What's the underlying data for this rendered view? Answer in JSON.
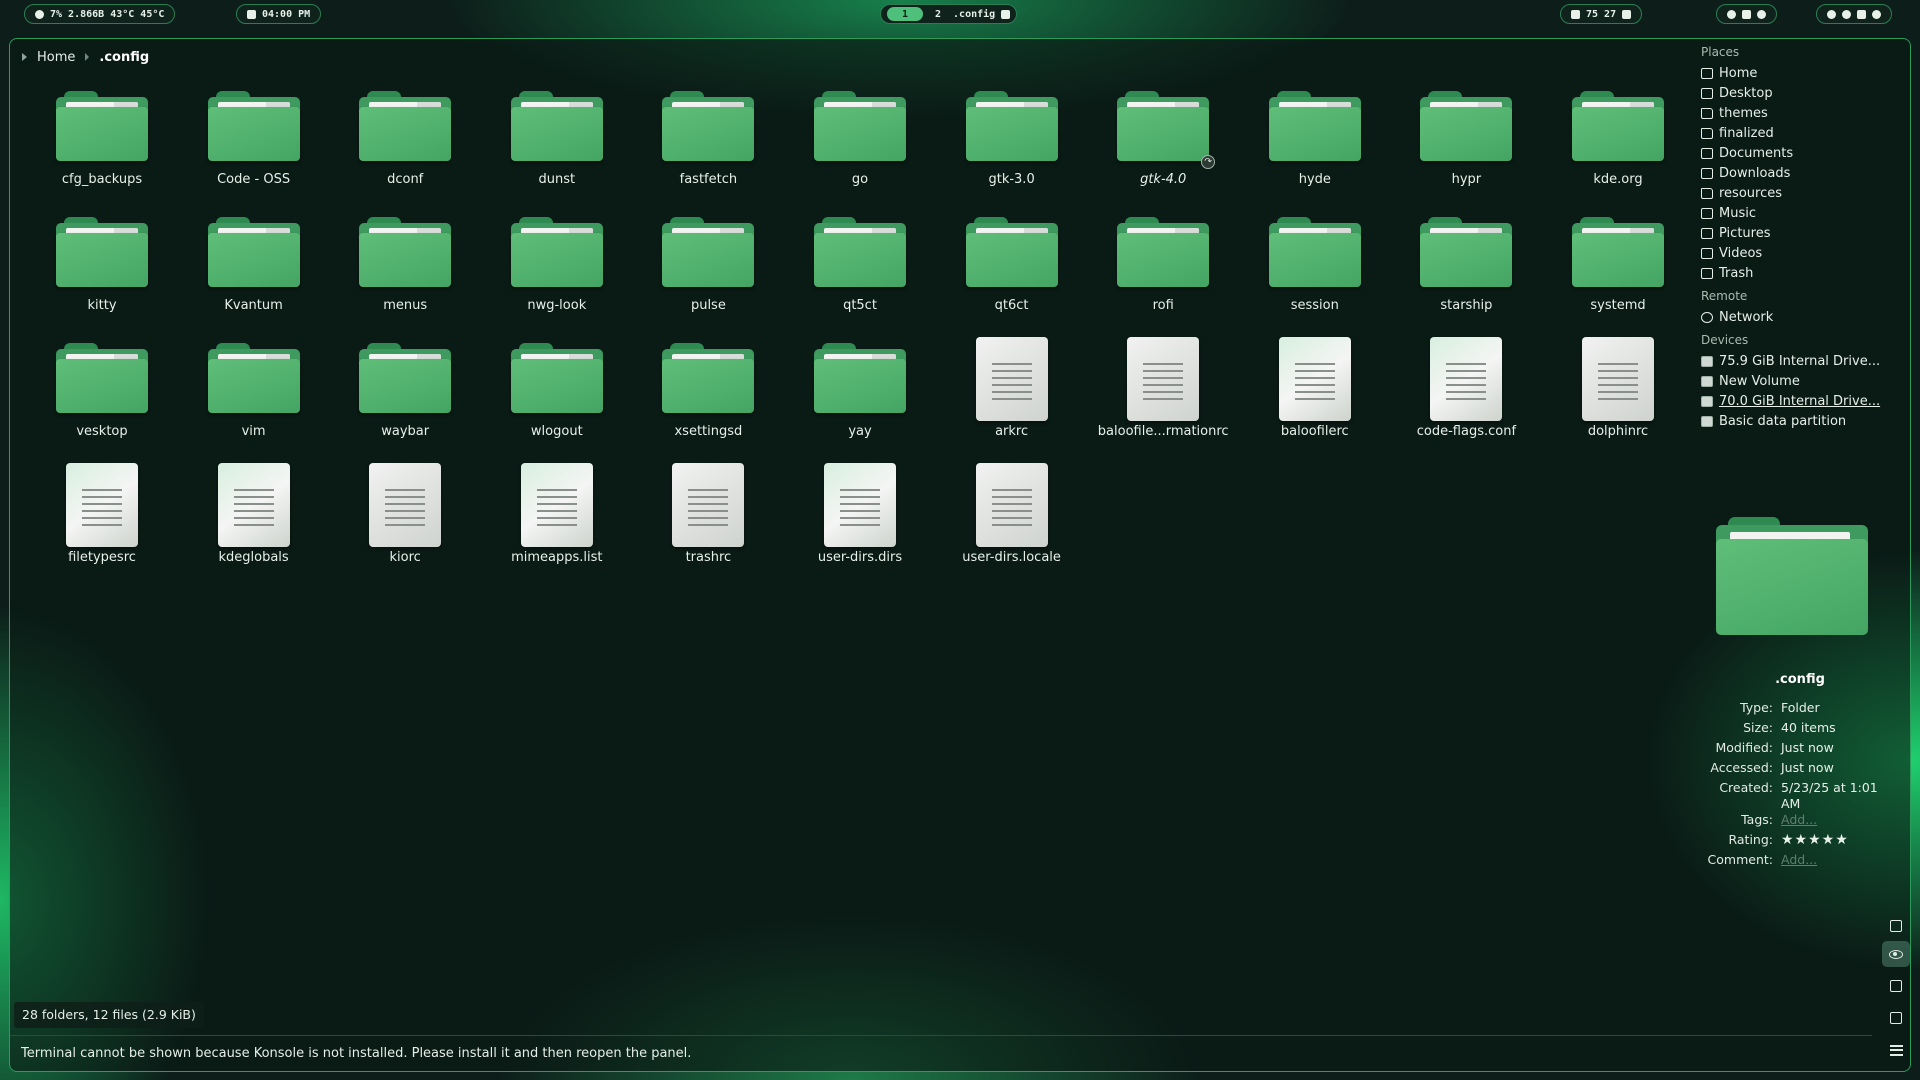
{
  "topbar": {
    "stats": "7%  2.866B  43°C  45°C",
    "clock": "04:00 PM",
    "workspaces": [
      "1",
      "2"
    ],
    "active_workspace": "1",
    "window_title": ".config",
    "tray": "75  27"
  },
  "breadcrumb": {
    "home": "Home",
    "current": ".config"
  },
  "items": [
    {
      "name": "cfg_backups",
      "kind": "folder"
    },
    {
      "name": "Code - OSS",
      "kind": "folder"
    },
    {
      "name": "dconf",
      "kind": "folder"
    },
    {
      "name": "dunst",
      "kind": "folder"
    },
    {
      "name": "fastfetch",
      "kind": "folder"
    },
    {
      "name": "go",
      "kind": "folder"
    },
    {
      "name": "gtk-3.0",
      "kind": "folder"
    },
    {
      "name": "gtk-4.0",
      "kind": "folder",
      "link": true
    },
    {
      "name": "hyde",
      "kind": "folder"
    },
    {
      "name": "hypr",
      "kind": "folder"
    },
    {
      "name": "kde.org",
      "kind": "folder"
    },
    {
      "name": "kitty",
      "kind": "folder"
    },
    {
      "name": "Kvantum",
      "kind": "folder"
    },
    {
      "name": "menus",
      "kind": "folder"
    },
    {
      "name": "nwg-look",
      "kind": "folder"
    },
    {
      "name": "pulse",
      "kind": "folder"
    },
    {
      "name": "qt5ct",
      "kind": "folder"
    },
    {
      "name": "qt6ct",
      "kind": "folder"
    },
    {
      "name": "rofi",
      "kind": "folder"
    },
    {
      "name": "session",
      "kind": "folder"
    },
    {
      "name": "starship",
      "kind": "folder"
    },
    {
      "name": "systemd",
      "kind": "folder"
    },
    {
      "name": "vesktop",
      "kind": "folder"
    },
    {
      "name": "vim",
      "kind": "folder"
    },
    {
      "name": "waybar",
      "kind": "folder"
    },
    {
      "name": "wlogout",
      "kind": "folder"
    },
    {
      "name": "xsettingsd",
      "kind": "folder"
    },
    {
      "name": "yay",
      "kind": "folder"
    },
    {
      "name": "arkrc",
      "kind": "file"
    },
    {
      "name": "baloofile...rmationrc",
      "kind": "file"
    },
    {
      "name": "baloofilerc",
      "kind": "file",
      "tint": true
    },
    {
      "name": "code-flags.conf",
      "kind": "file",
      "tint": true
    },
    {
      "name": "dolphinrc",
      "kind": "file"
    },
    {
      "name": "filetypesrc",
      "kind": "file",
      "tint": true
    },
    {
      "name": "kdeglobals",
      "kind": "file",
      "tint": true
    },
    {
      "name": "kiorc",
      "kind": "file"
    },
    {
      "name": "mimeapps.list",
      "kind": "file",
      "tint": true
    },
    {
      "name": "trashrc",
      "kind": "file"
    },
    {
      "name": "user-dirs.dirs",
      "kind": "file",
      "tint": true
    },
    {
      "name": "user-dirs.locale",
      "kind": "file"
    }
  ],
  "places": {
    "places_heading": "Places",
    "places": [
      {
        "label": "Home",
        "icon": "home-icon"
      },
      {
        "label": "Desktop",
        "icon": "desktop-icon"
      },
      {
        "label": "themes",
        "icon": "folder-icon"
      },
      {
        "label": "finalized",
        "icon": "folder-icon"
      },
      {
        "label": "Documents",
        "icon": "document-icon"
      },
      {
        "label": "Downloads",
        "icon": "download-icon"
      },
      {
        "label": "resources",
        "icon": "folder-icon"
      },
      {
        "label": "Music",
        "icon": "music-icon"
      },
      {
        "label": "Pictures",
        "icon": "pictures-icon"
      },
      {
        "label": "Videos",
        "icon": "videos-icon"
      },
      {
        "label": "Trash",
        "icon": "trash-icon"
      }
    ],
    "remote_heading": "Remote",
    "remote": [
      {
        "label": "Network",
        "icon": "network-icon"
      }
    ],
    "devices_heading": "Devices",
    "devices": [
      {
        "label": "75.9 GiB Internal Drive...",
        "icon": "drive-icon"
      },
      {
        "label": "New Volume",
        "icon": "drive-icon"
      },
      {
        "label": "70.0 GiB Internal Drive...",
        "icon": "drive-icon",
        "underline": true
      },
      {
        "label": "Basic data partition",
        "icon": "drive-icon"
      }
    ]
  },
  "info": {
    "name": ".config",
    "rows": [
      {
        "key": "Type:",
        "value": "Folder"
      },
      {
        "key": "Size:",
        "value": "40 items"
      },
      {
        "key": "Modified:",
        "value": "Just now"
      },
      {
        "key": "Accessed:",
        "value": "Just now"
      },
      {
        "key": "Created:",
        "value": "5/23/25 at 1:01 AM"
      },
      {
        "key": "Tags:",
        "value": "Add...",
        "muted": true
      },
      {
        "key": "Rating:",
        "value": "★★★★★",
        "rating": 0
      },
      {
        "key": "Comment:",
        "value": "Add...",
        "muted": true
      }
    ]
  },
  "status": {
    "summary": "28 folders, 12 files (2.9 KiB)",
    "terminal": "Terminal cannot be shown because Konsole is not installed. Please install it and then reopen the panel."
  },
  "colors": {
    "accent": "#2d9b5c",
    "folder": "#52b16d"
  }
}
